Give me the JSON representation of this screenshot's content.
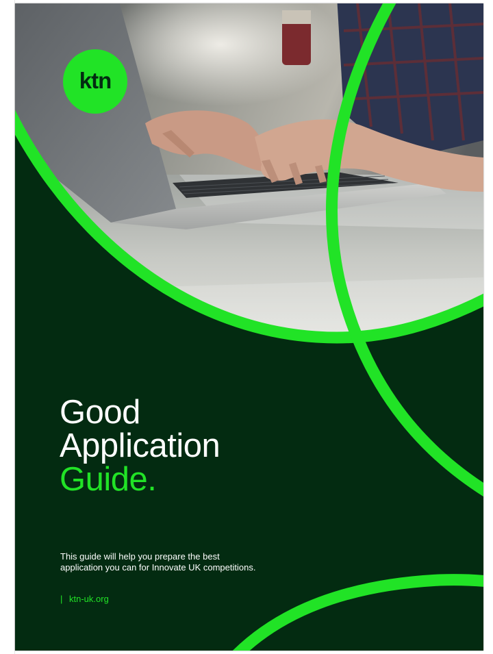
{
  "brand": {
    "logo_text": "ktn",
    "accent_color": "#21e326",
    "background_color": "#032b11"
  },
  "cover": {
    "title_line1": "Good",
    "title_line2": "Application",
    "title_line3": "Guide.",
    "description": "This guide will help you prepare the best application you can for Innovate UK competitions.",
    "url_separator": "|",
    "url": "ktn-uk.org"
  },
  "photo": {
    "subject": "hands typing on a laptop keyboard"
  }
}
